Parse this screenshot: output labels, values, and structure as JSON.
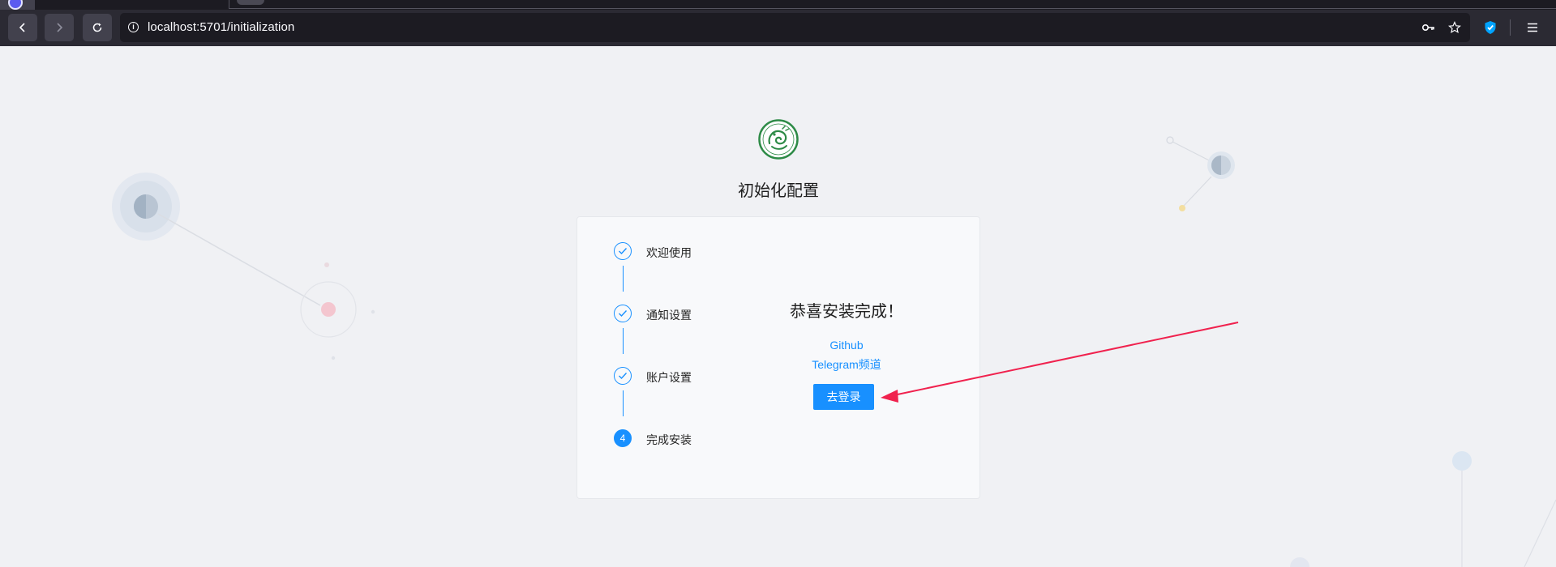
{
  "browser": {
    "url": "localhost:5701/initialization",
    "nav": {
      "back_icon": "arrow-left-icon",
      "forward_icon": "arrow-right-icon",
      "reload_icon": "reload-icon"
    },
    "url_icons": [
      "site-info-icon",
      "key-icon",
      "bookmark-star-icon"
    ],
    "toolbar_icons": [
      "shield-extension-icon",
      "menu-icon"
    ]
  },
  "page": {
    "title": "初始化配置",
    "logo_icon": "dragon-logo-icon",
    "steps": [
      {
        "label": "欢迎使用",
        "status": "finish"
      },
      {
        "label": "通知设置",
        "status": "finish"
      },
      {
        "label": "账户设置",
        "status": "finish"
      },
      {
        "label": "完成安装",
        "status": "process",
        "number": "4"
      }
    ],
    "result": {
      "title": "恭喜安装完成！",
      "links": [
        "Github",
        "Telegram频道"
      ],
      "button_label": "去登录"
    }
  },
  "colors": {
    "primary": "#1890ff",
    "annotation_arrow": "#f0224e",
    "page_background": "#f0f1f4",
    "logo_green": "#2e8b47"
  }
}
